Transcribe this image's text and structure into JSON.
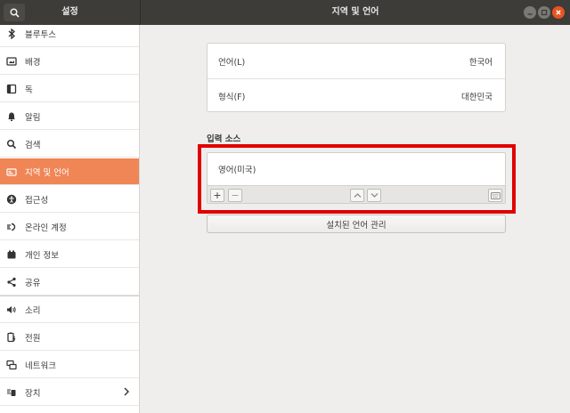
{
  "window": {
    "sidebar_title": "설정",
    "title": "지역 및 언어"
  },
  "sidebar": {
    "items": [
      {
        "label": "블루투스",
        "icon": "bluetooth-icon"
      },
      {
        "label": "배경",
        "icon": "background-icon"
      },
      {
        "label": "독",
        "icon": "dock-icon"
      },
      {
        "label": "알림",
        "icon": "bell-icon"
      },
      {
        "label": "검색",
        "icon": "search-icon"
      },
      {
        "label": "지역 및 언어",
        "icon": "region-icon",
        "active": true
      },
      {
        "label": "접근성",
        "icon": "accessibility-icon"
      },
      {
        "label": "온라인 계정",
        "icon": "online-accounts-icon"
      },
      {
        "label": "개인 정보",
        "icon": "privacy-icon"
      },
      {
        "label": "공유",
        "icon": "share-icon"
      },
      {
        "label": "소리",
        "icon": "sound-icon"
      },
      {
        "label": "전원",
        "icon": "power-icon"
      },
      {
        "label": "네트워크",
        "icon": "network-icon"
      },
      {
        "label": "장치",
        "icon": "devices-icon",
        "has_chevron": true
      }
    ],
    "accent_color": "#f08556"
  },
  "main": {
    "language_label": "언어(L)",
    "language_value": "한국어",
    "formats_label": "형식(F)",
    "formats_value": "대한민국",
    "input_sources_title": "입력 소스",
    "input_sources": [
      "영어(미국)"
    ],
    "add_symbol": "+",
    "remove_symbol": "−",
    "manage_button": "설치된 언어 관리"
  },
  "colors": {
    "titlebar": "#3d3c39",
    "close_button": "#e95420",
    "highlight": "#e00000"
  }
}
